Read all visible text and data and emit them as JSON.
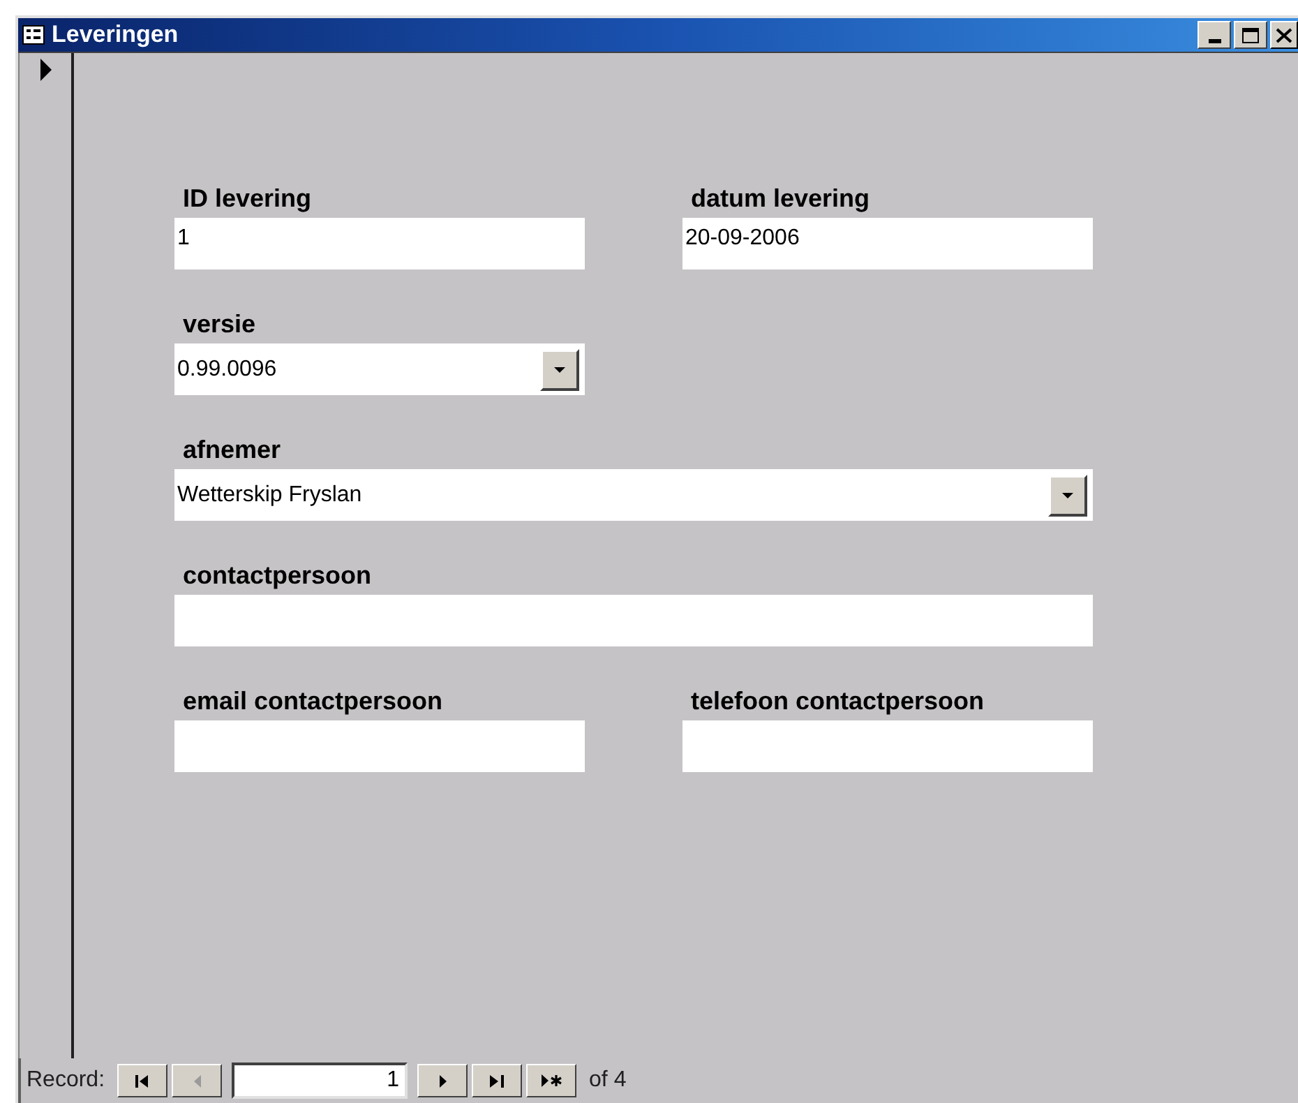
{
  "window": {
    "title": "Leveringen"
  },
  "record_selector": {
    "current": true
  },
  "rows": [
    [
      {
        "label": "ID levering",
        "kind": "text",
        "value": "1",
        "wide": false
      },
      {
        "label": "datum levering",
        "kind": "text",
        "value": "20-09-2006",
        "wide": false
      }
    ],
    [
      {
        "label": "versie",
        "kind": "combo",
        "value": "0.99.0096",
        "wide": false
      }
    ],
    [
      {
        "label": "afnemer",
        "kind": "combo",
        "value": "Wetterskip Fryslan",
        "wide": true
      }
    ],
    [
      {
        "label": "contactpersoon",
        "kind": "text",
        "wide": true
      }
    ],
    [
      {
        "label": "email contactpersoon",
        "kind": "text",
        "wide": false
      },
      {
        "label": "telefoon contactpersoon",
        "kind": "text",
        "wide": false
      }
    ]
  ],
  "navigation": {
    "label": "Record:",
    "current": "1",
    "total": "of 4",
    "buttons": [
      {
        "kind": "first",
        "disabled": false
      },
      {
        "kind": "previous",
        "disabled": true
      },
      {
        "kind": "next",
        "disabled": false
      },
      {
        "kind": "last",
        "disabled": false
      },
      {
        "kind": "new",
        "disabled": false
      }
    ]
  }
}
